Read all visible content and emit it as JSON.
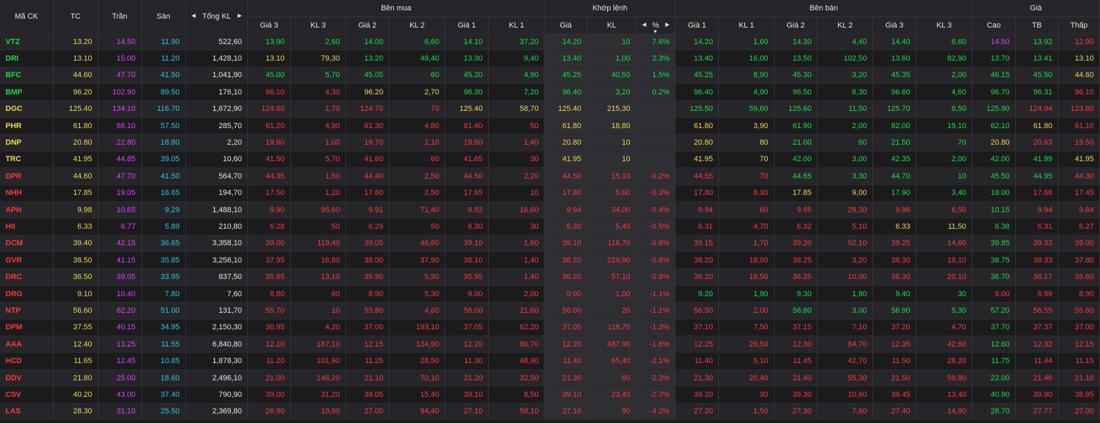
{
  "headers": {
    "symbol": "Mã CK",
    "ref": "TC",
    "ceil": "Trần",
    "floor": "Sàn",
    "total_vol": "Tổng KL",
    "buy_group": "Bên mua",
    "match_group": "Khớp lệnh",
    "sell_group": "Bên bán",
    "price_group": "Giá",
    "buy_cols": [
      "Giá 3",
      "KL 3",
      "Giá 2",
      "KL 2",
      "Giá 1",
      "KL 1"
    ],
    "match_cols": [
      "Giá",
      "KL",
      "%"
    ],
    "sell_cols": [
      "Giá 1",
      "KL 1",
      "Giá 2",
      "KL 2",
      "Giá 3",
      "KL 3"
    ],
    "price_cols": [
      "Cao",
      "TB",
      "Thấp"
    ],
    "left_arrow": "◀",
    "right_arrow": "▶",
    "sort_indicator": "▼"
  },
  "colors": {
    "up": "#19e03f",
    "down": "#ff3838",
    "ref": "#f0d84c",
    "ceil": "#e040fb",
    "floor": "#29c7e6"
  },
  "rows": [
    {
      "s": "VTZ",
      "tc": "13.20",
      "tr": "14.50",
      "sa": "11.90",
      "tkl": "522,60",
      "b": [
        "13.90",
        "2,60",
        "14.00",
        "6,60",
        "14.10",
        "37,20"
      ],
      "m": [
        "14.20",
        "10",
        "7.6%"
      ],
      "se": [
        "14.20",
        "1,60",
        "14.30",
        "4,40",
        "14.40",
        "6,60"
      ],
      "p": [
        "14.50",
        "13.92",
        "12.90"
      ]
    },
    {
      "s": "DRI",
      "tc": "13.10",
      "tr": "15.00",
      "sa": "11.20",
      "tkl": "1,428,10",
      "b": [
        "13.10",
        "79,30",
        "13.20",
        "48,40",
        "13.30",
        "9,40"
      ],
      "m": [
        "13.40",
        "1,00",
        "2.3%"
      ],
      "se": [
        "13.40",
        "16,00",
        "13.50",
        "102,50",
        "13.60",
        "82,90"
      ],
      "p": [
        "13.70",
        "13.41",
        "13.10"
      ]
    },
    {
      "s": "BFC",
      "tc": "44.60",
      "tr": "47.70",
      "sa": "41.50",
      "tkl": "1,041,90",
      "b": [
        "45.00",
        "5,70",
        "45.05",
        "60",
        "45.20",
        "4,90"
      ],
      "m": [
        "45.25",
        "40,50",
        "1.5%"
      ],
      "se": [
        "45.25",
        "8,90",
        "45.30",
        "3,20",
        "45.35",
        "2,00"
      ],
      "p": [
        "46.15",
        "45.50",
        "44.60"
      ]
    },
    {
      "s": "BMP",
      "tc": "96.20",
      "tr": "102.90",
      "sa": "89.50",
      "tkl": "176,10",
      "b": [
        "96.10",
        "4,30",
        "96.20",
        "2,70",
        "96.30",
        "7,20"
      ],
      "m": [
        "96.40",
        "3,20",
        "0.2%"
      ],
      "se": [
        "96.40",
        "4,90",
        "96.50",
        "6,30",
        "96.60",
        "4,60"
      ],
      "p": [
        "96.70",
        "96.31",
        "96.10"
      ]
    },
    {
      "s": "DGC",
      "tc": "125.40",
      "tr": "134.10",
      "sa": "116.70",
      "tkl": "1,672,90",
      "b": [
        "124.60",
        "1,70",
        "124.70",
        "70",
        "125.40",
        "58,70"
      ],
      "m": [
        "125.40",
        "215,30",
        ""
      ],
      "se": [
        "125.50",
        "59,60",
        "125.60",
        "11,50",
        "125.70",
        "6,50"
      ],
      "p": [
        "125.90",
        "124.94",
        "123.80"
      ]
    },
    {
      "s": "PHR",
      "tc": "61.80",
      "tr": "66.10",
      "sa": "57.50",
      "tkl": "285,70",
      "b": [
        "61.20",
        "4,90",
        "61.30",
        "4,80",
        "61.40",
        "50"
      ],
      "m": [
        "61.80",
        "18,80",
        ""
      ],
      "se": [
        "61.80",
        "3,90",
        "61.90",
        "2,00",
        "62.00",
        "19,10"
      ],
      "p": [
        "62.10",
        "61.80",
        "61.10"
      ]
    },
    {
      "s": "DNP",
      "tc": "20.80",
      "tr": "22.80",
      "sa": "18.80",
      "tkl": "2,20",
      "b": [
        "19.60",
        "1,00",
        "19.70",
        "1,10",
        "19.80",
        "1,40"
      ],
      "m": [
        "20.80",
        "10",
        ""
      ],
      "se": [
        "20.80",
        "80",
        "21.00",
        "60",
        "21.50",
        "70"
      ],
      "p": [
        "20.80",
        "20.63",
        "19.50"
      ]
    },
    {
      "s": "TRC",
      "tc": "41.95",
      "tr": "44.85",
      "sa": "39.05",
      "tkl": "10,60",
      "b": [
        "41.50",
        "5,70",
        "41.60",
        "60",
        "41.65",
        "30"
      ],
      "m": [
        "41.95",
        "10",
        ""
      ],
      "se": [
        "41.95",
        "70",
        "42.00",
        "3,00",
        "42.35",
        "2,00"
      ],
      "p": [
        "42.00",
        "41.99",
        "41.95"
      ]
    },
    {
      "s": "DPR",
      "tc": "44.60",
      "tr": "47.70",
      "sa": "41.50",
      "tkl": "564,70",
      "b": [
        "44.35",
        "1,50",
        "44.40",
        "2,50",
        "44.50",
        "2,20"
      ],
      "m": [
        "44.50",
        "15,10",
        "-0.2%"
      ],
      "se": [
        "44.55",
        "70",
        "44.65",
        "3,30",
        "44.70",
        "10"
      ],
      "p": [
        "45.50",
        "44.95",
        "44.30"
      ]
    },
    {
      "s": "NHH",
      "tc": "17.85",
      "tr": "19.05",
      "sa": "16.65",
      "tkl": "194,70",
      "b": [
        "17.50",
        "1,20",
        "17.60",
        "2,50",
        "17.65",
        "10"
      ],
      "m": [
        "17.80",
        "5,60",
        "-0.3%"
      ],
      "se": [
        "17.80",
        "8,30",
        "17.85",
        "9,00",
        "17.90",
        "3,40"
      ],
      "p": [
        "18.00",
        "17.68",
        "17.45"
      ]
    },
    {
      "s": "APH",
      "tc": "9.98",
      "tr": "10.65",
      "sa": "9.29",
      "tkl": "1,488,10",
      "b": [
        "9.90",
        "95,60",
        "9.91",
        "71,40",
        "9.92",
        "16,60"
      ],
      "m": [
        "9.94",
        "34,00",
        "-0.4%"
      ],
      "se": [
        "9.94",
        "60",
        "9.95",
        "29,30",
        "9.96",
        "6,50"
      ],
      "p": [
        "10.15",
        "9.94",
        "9.84"
      ]
    },
    {
      "s": "HII",
      "tc": "6.33",
      "tr": "6.77",
      "sa": "5.89",
      "tkl": "210,80",
      "b": [
        "6.28",
        "50",
        "6.29",
        "50",
        "6.30",
        "30"
      ],
      "m": [
        "6.30",
        "5,40",
        "-0.5%"
      ],
      "se": [
        "6.31",
        "4,70",
        "6.32",
        "5,10",
        "6.33",
        "11,50"
      ],
      "p": [
        "6.38",
        "6.31",
        "6.27"
      ]
    },
    {
      "s": "DCM",
      "tc": "39.40",
      "tr": "42.15",
      "sa": "36.65",
      "tkl": "3,358,10",
      "b": [
        "39.00",
        "119,40",
        "39.05",
        "46,60",
        "39.10",
        "1,60"
      ],
      "m": [
        "39.10",
        "116,70",
        "-0.8%"
      ],
      "se": [
        "39.15",
        "1,70",
        "39.20",
        "92,10",
        "39.25",
        "14,60"
      ],
      "p": [
        "39.85",
        "39.33",
        "39.00"
      ]
    },
    {
      "s": "GVR",
      "tc": "38.50",
      "tr": "41.15",
      "sa": "35.85",
      "tkl": "3,256,10",
      "b": [
        "37.95",
        "16,80",
        "38.00",
        "37,90",
        "38.10",
        "1,40"
      ],
      "m": [
        "38.20",
        "219,90",
        "-0.8%"
      ],
      "se": [
        "38.20",
        "18,90",
        "38.25",
        "3,20",
        "38.30",
        "18,10"
      ],
      "p": [
        "38.75",
        "38.33",
        "37.80"
      ]
    },
    {
      "s": "DRC",
      "tc": "36.50",
      "tr": "39.05",
      "sa": "33.95",
      "tkl": "837,50",
      "b": [
        "35.85",
        "13,10",
        "35.90",
        "5,90",
        "35.95",
        "1,40"
      ],
      "m": [
        "36.20",
        "57,10",
        "-0.8%"
      ],
      "se": [
        "36.20",
        "16,50",
        "36.25",
        "10,00",
        "36.30",
        "20,10"
      ],
      "p": [
        "36.70",
        "36.17",
        "35.60"
      ]
    },
    {
      "s": "DRG",
      "tc": "9.10",
      "tr": "10.40",
      "sa": "7.80",
      "tkl": "7,60",
      "b": [
        "8.80",
        "60",
        "8.90",
        "5,30",
        "9.00",
        "2,00"
      ],
      "m": [
        "9.00",
        "1,00",
        "-1.1%"
      ],
      "se": [
        "9.20",
        "1,90",
        "9.30",
        "1,80",
        "9.40",
        "30"
      ],
      "p": [
        "9.00",
        "8.99",
        "8.90"
      ]
    },
    {
      "s": "NTP",
      "tc": "56.60",
      "tr": "62.20",
      "sa": "51.00",
      "tkl": "131,70",
      "b": [
        "55.70",
        "10",
        "55.80",
        "4,60",
        "56.00",
        "21,60"
      ],
      "m": [
        "56.00",
        "20",
        "-1.1%"
      ],
      "se": [
        "56.50",
        "2,00",
        "56.80",
        "3,00",
        "56.90",
        "5,30"
      ],
      "p": [
        "57.20",
        "56.55",
        "55.60"
      ]
    },
    {
      "s": "DPM",
      "tc": "37.55",
      "tr": "40.15",
      "sa": "34.95",
      "tkl": "2,150,30",
      "b": [
        "36.95",
        "4,20",
        "37.00",
        "193,10",
        "37.05",
        "62,20"
      ],
      "m": [
        "37.05",
        "118,70",
        "-1.3%"
      ],
      "se": [
        "37.10",
        "7,50",
        "37.15",
        "7,10",
        "37.20",
        "4,70"
      ],
      "p": [
        "37.70",
        "37.37",
        "37.00"
      ]
    },
    {
      "s": "AAA",
      "tc": "12.40",
      "tr": "13.25",
      "sa": "11.55",
      "tkl": "6,840,80",
      "b": [
        "12.10",
        "187,10",
        "12.15",
        "134,90",
        "12.20",
        "80,70"
      ],
      "m": [
        "12.20",
        "487,90",
        "-1.6%"
      ],
      "se": [
        "12.25",
        "26,50",
        "12.30",
        "84,70",
        "12.35",
        "42,60"
      ],
      "p": [
        "12.60",
        "12.32",
        "12.15"
      ]
    },
    {
      "s": "HCD",
      "tc": "11.65",
      "tr": "12.45",
      "sa": "10.85",
      "tkl": "1,878,30",
      "b": [
        "11.20",
        "101,90",
        "11.25",
        "28,50",
        "11.30",
        "48,90"
      ],
      "m": [
        "11.40",
        "65,40",
        "-2.1%"
      ],
      "se": [
        "11.40",
        "5,10",
        "11.45",
        "42,70",
        "11.50",
        "28,20"
      ],
      "p": [
        "11.75",
        "11.44",
        "11.15"
      ]
    },
    {
      "s": "DDV",
      "tc": "21.80",
      "tr": "25.00",
      "sa": "18.60",
      "tkl": "2,496,10",
      "b": [
        "21.00",
        "146,20",
        "21.10",
        "70,10",
        "21.20",
        "32,50"
      ],
      "m": [
        "21.30",
        "60",
        "-2.3%"
      ],
      "se": [
        "21.30",
        "20,40",
        "21.40",
        "55,30",
        "21.50",
        "59,80"
      ],
      "p": [
        "22.00",
        "21.46",
        "21.10"
      ]
    },
    {
      "s": "CSV",
      "tc": "40.20",
      "tr": "43.00",
      "sa": "37.40",
      "tkl": "790,90",
      "b": [
        "39.00",
        "31,20",
        "39.05",
        "15,40",
        "39.10",
        "8,50"
      ],
      "m": [
        "39.10",
        "23,40",
        "-2.7%"
      ],
      "se": [
        "39.20",
        "30",
        "39.30",
        "10,60",
        "39.45",
        "13,40"
      ],
      "p": [
        "40.90",
        "39.90",
        "38.95"
      ]
    },
    {
      "s": "LAS",
      "tc": "28.30",
      "tr": "31.10",
      "sa": "25.50",
      "tkl": "2,369,80",
      "b": [
        "26.90",
        "19,90",
        "27.00",
        "94,40",
        "27.10",
        "58,10"
      ],
      "m": [
        "27.10",
        "90",
        "-4.2%"
      ],
      "se": [
        "27.20",
        "1,50",
        "27.30",
        "7,60",
        "27.40",
        "14,90"
      ],
      "p": [
        "28.70",
        "27.77",
        "27.00"
      ]
    }
  ]
}
